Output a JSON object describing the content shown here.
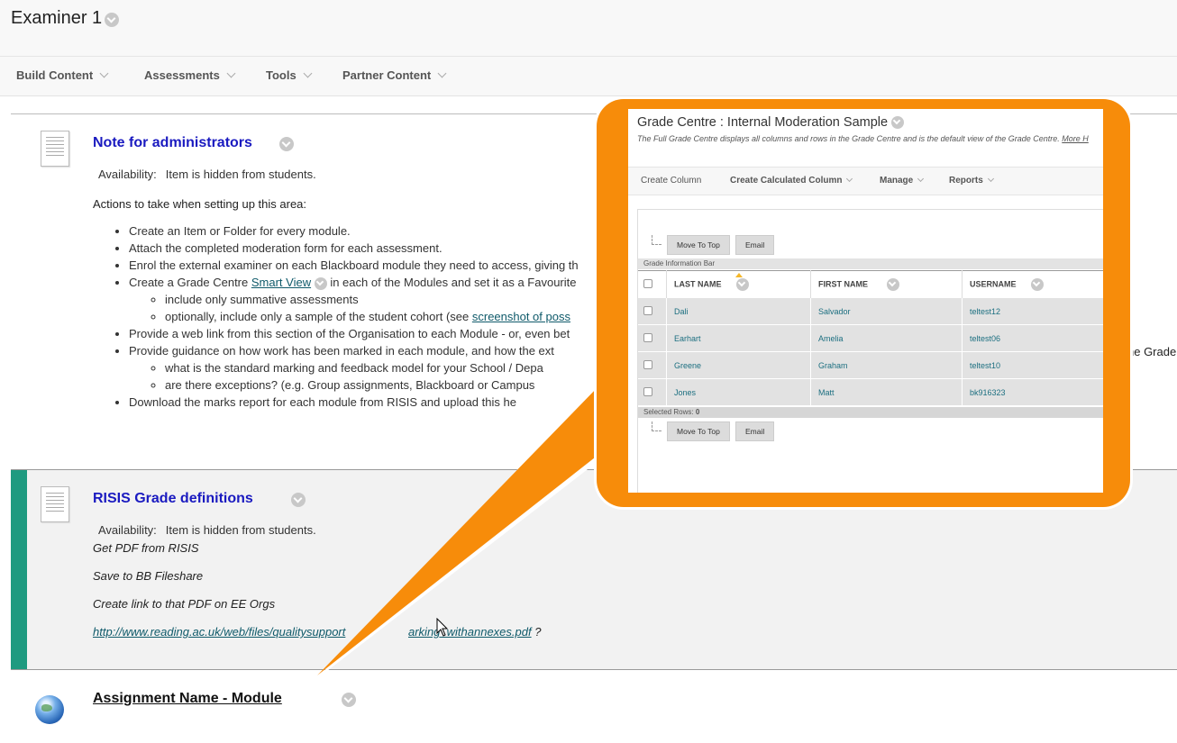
{
  "page": {
    "title": "Examiner 1"
  },
  "action_bar": {
    "build_content": "Build Content",
    "assessments": "Assessments",
    "tools": "Tools",
    "partner_content": "Partner Content"
  },
  "item1": {
    "title": "Note for administrators",
    "availability_label": "Availability:",
    "availability_value": "Item is hidden from students.",
    "intro": "Actions to take when setting up this area:",
    "bullet1": "Create an Item or Folder for every module.",
    "bullet2": "Attach the completed moderation form for each assessment.",
    "bullet3": "Enrol the external examiner on each Blackboard module they need to access, giving th",
    "bullet4_pre": "Create a Grade Centre ",
    "bullet4_link": "Smart View",
    "bullet4_post": " in each of the Modules and set it as a Favourite",
    "sub4a": "include only summative assessments",
    "sub4b_pre": "optionally, include only a sample of the student cohort (see ",
    "sub4b_link": "screenshot of poss",
    "bullet5": "Provide a web link from this section of the Organisation to each Module - or, even bet",
    "bullet6": "Provide guidance on how work has been marked in each module, and how the ext",
    "bullet6_tail": "he Grade",
    "sub6a": "what is the standard marking and feedback model for your School / Depa",
    "sub6b": "are there exceptions? (e.g. Group assignments, Blackboard or Campus",
    "bullet7": "Download the marks report for each module from RISIS and upload this he"
  },
  "item2": {
    "title": "RISIS Grade definitions",
    "availability_label": "Availability:",
    "availability_value": "Item is hidden from students.",
    "line1": "Get PDF from RISIS",
    "line2": "Save to BB Fileshare",
    "line3": "Create link to that PDF on EE Orgs",
    "link_part1": "http://www.reading.ac.uk/web/files/qualitysupport",
    "link_part2": "arking_withannexes.pdf",
    "link_suffix": " ?"
  },
  "item3": {
    "title": "Assignment Name - Module"
  },
  "grade_centre": {
    "title": "Grade Centre : Internal Moderation Sample",
    "description": "The Full Grade Centre displays all columns and rows in the Grade Centre and is the default view of the Grade Centre.",
    "more_link": "More H",
    "menu": {
      "create_column": "Create Column",
      "create_calculated_column": "Create Calculated Column",
      "manage": "Manage",
      "reports": "Reports"
    },
    "move_to_top": "Move To Top",
    "email": "Email",
    "info_bar": "Grade Information Bar",
    "selected_rows": "Selected Rows:",
    "selected_count": "0",
    "columns": [
      "LAST NAME",
      "FIRST NAME",
      "USERNAME"
    ],
    "rows": [
      [
        "Dali",
        "Salvador",
        "teltest12"
      ],
      [
        "Earhart",
        "Amelia",
        "teltest06"
      ],
      [
        "Greene",
        "Graham",
        "teltest10"
      ],
      [
        "Jones",
        "Matt",
        "bk916323"
      ]
    ]
  },
  "colors": {
    "callout_orange": "#f78c0a",
    "item_title_blue": "#1a1ac0",
    "status_bar_green": "#1f9a80"
  },
  "icons": {
    "title_menu": "chevron-down-icon",
    "item_type_document": "document-icon",
    "item_type_link": "globe-icon",
    "cursor": "mouse-pointer-icon"
  }
}
